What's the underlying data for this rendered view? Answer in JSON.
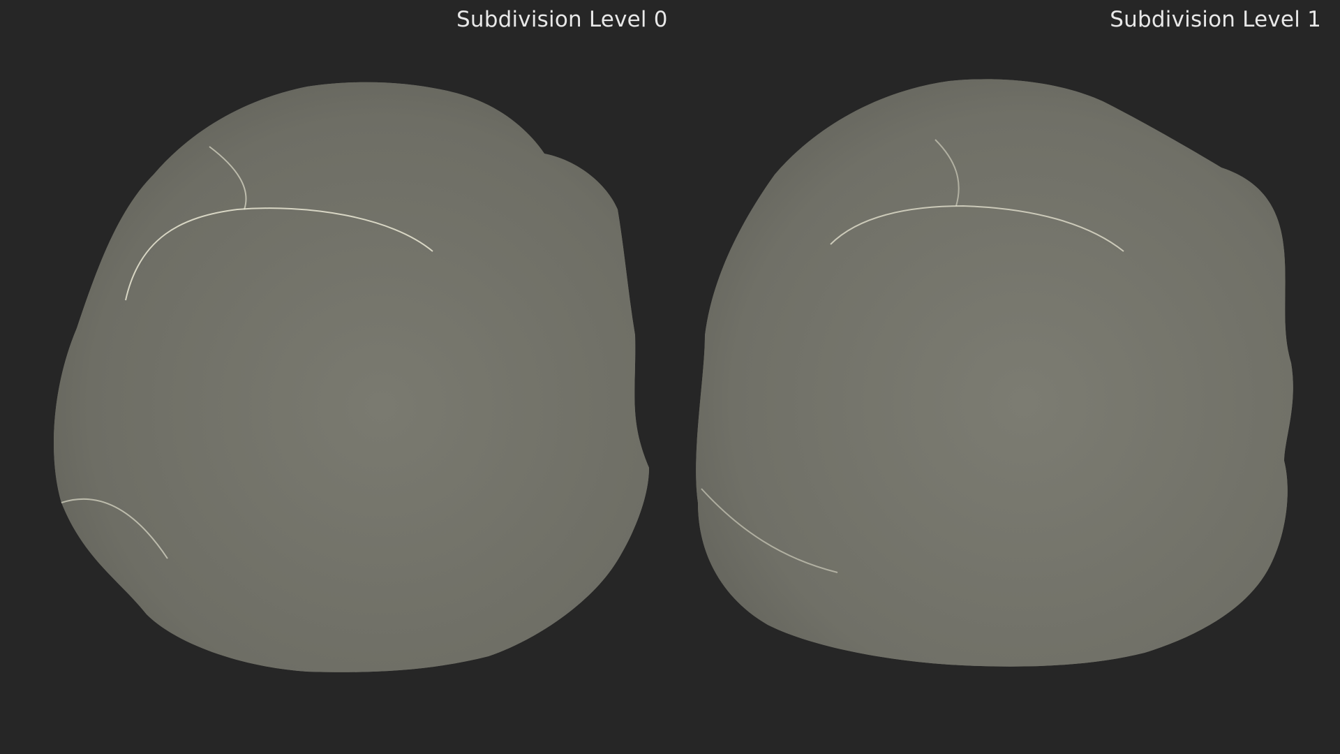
{
  "labels": {
    "level0": "Subdivision Level 0",
    "level1": "Subdivision Level 1"
  },
  "colors": {
    "background": "#262626",
    "mesh_fill": "#74746a",
    "wire": "#f2f0dc",
    "label_text": "#e8e8e8"
  }
}
